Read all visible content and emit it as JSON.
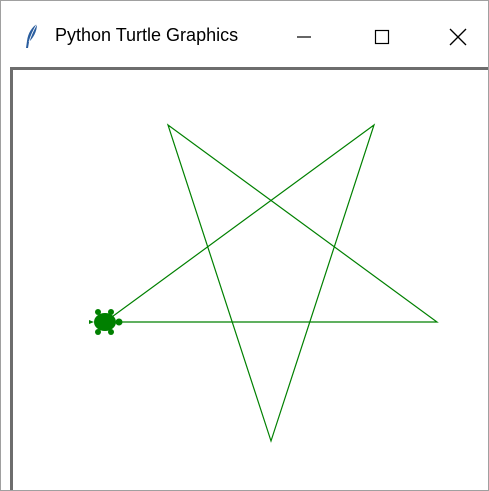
{
  "window": {
    "title": "Python Turtle Graphics",
    "app_icon": "feather-icon",
    "controls": {
      "minimize_icon": "minimize-icon",
      "maximize_icon": "maximize-icon",
      "close_icon": "close-icon"
    }
  },
  "canvas": {
    "background": "#ffffff",
    "pen_color": "#008000",
    "shape": "five-pointed-star",
    "turtle_shape": "turtle-icon",
    "turtle_color": "#008000"
  }
}
